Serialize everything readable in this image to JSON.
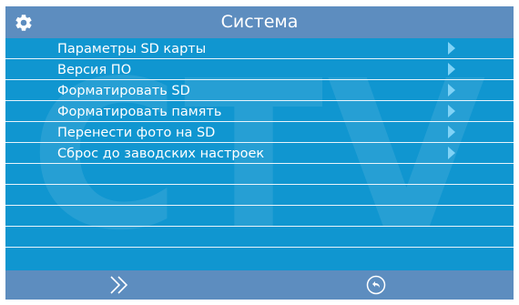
{
  "header": {
    "title": "Система",
    "icon": "gear-icon"
  },
  "watermark": "CTV",
  "menu": {
    "items": [
      {
        "label": "Параметры SD карты",
        "has_arrow": true
      },
      {
        "label": "Версия ПО",
        "has_arrow": true
      },
      {
        "label": "Форматировать SD",
        "has_arrow": true
      },
      {
        "label": "Форматировать память",
        "has_arrow": true
      },
      {
        "label": "Перенести фото на SD",
        "has_arrow": true
      },
      {
        "label": "Сброс до заводских настроек",
        "has_arrow": true
      },
      {
        "label": "",
        "has_arrow": false
      },
      {
        "label": "",
        "has_arrow": false
      },
      {
        "label": "",
        "has_arrow": false
      },
      {
        "label": "",
        "has_arrow": false
      }
    ]
  },
  "footer": {
    "next_icon": "double-chevron-right-icon",
    "back_icon": "return-arrow-icon"
  },
  "colors": {
    "background": "#1096d0",
    "bar": "#5d8dbf",
    "text": "#ffffff",
    "arrow": "#7fd3f7",
    "divider": "#e8f4fb"
  }
}
